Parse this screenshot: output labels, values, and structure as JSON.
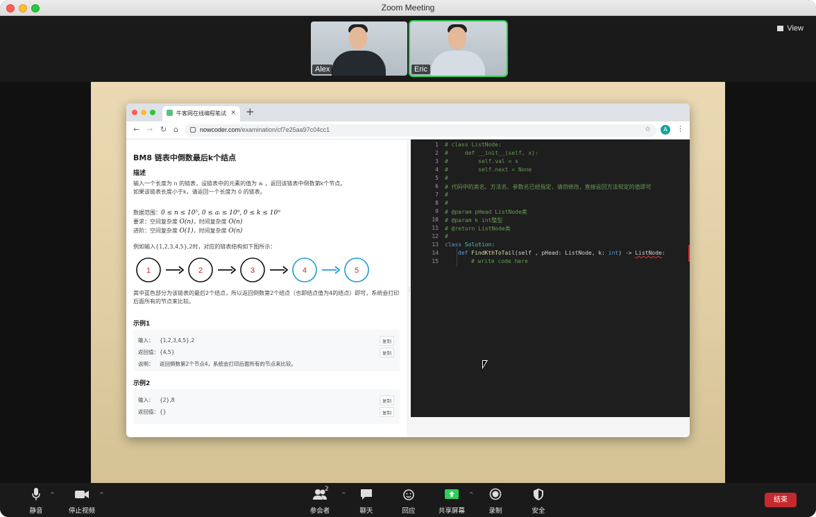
{
  "window": {
    "title": "Zoom Meeting"
  },
  "gallery": {
    "participants": [
      {
        "name": "Alex",
        "active": false
      },
      {
        "name": "Eric",
        "active": true
      }
    ],
    "view_label": "View"
  },
  "browser": {
    "tab_title": "牛客网在线编程笔试",
    "url_host": "nowcoder.com",
    "url_path": "/examination/cf7e25aa97c04cc1",
    "avatar_letter": "A"
  },
  "problem": {
    "title": "BM8  链表中倒数最后k个结点",
    "desc_heading": "描述",
    "desc_line1": "输入一个长度为 n 的链表，设链表中的元素的值为 aᵢ ，返回该链表中倒数第k个节点。",
    "desc_line2": "如果该链表长度小于k，请返回一个长度为 0 的链表。",
    "range_prefix": "数据范围：",
    "range_math": "0 ≤ n ≤ 10⁵,  0 ≤ aᵢ ≤ 10⁹,  0 ≤ k ≤ 10⁹",
    "req_prefix": "要求：空间复杂度 ",
    "req_math1": "O(n)",
    "req_mid": "，时间复杂度 ",
    "req_math2": "O(n)",
    "adv_prefix": "进阶：空间复杂度 ",
    "adv_math1": "O(1)",
    "adv_mid": "，时间复杂度 ",
    "adv_math2": "O(n)",
    "example_intro": "例如输入{1,2,3,4,5},2时，对应的链表结构如下图所示：",
    "diagram_nodes": [
      "1",
      "2",
      "3",
      "4",
      "5"
    ],
    "diagram_highlight_from": 3,
    "explain_line1": "其中蓝色部分为该链表的最后2个结点，所以返回倒数第2个结点（也即结点值为4的结点）即可，系统会打印",
    "explain_line2": "后面所有的节点来比较。",
    "example1": {
      "heading": "示例1",
      "input_label": "输入：",
      "input_value": "{1,2,3,4,5},2",
      "output_label": "返回值：",
      "output_value": "{4,5}",
      "note_label": "说明：",
      "note_value": "返回倒数第2个节点4，系统会打印后面所有的节点来比较。",
      "copy_label": "复制"
    },
    "example2": {
      "heading": "示例2",
      "input_label": "输入：",
      "input_value": "{2},8",
      "output_label": "返回值：",
      "output_value": "{}",
      "copy_label": "复制"
    }
  },
  "editor": {
    "line_numbers": [
      "1",
      "2",
      "3",
      "4",
      "5",
      "6",
      "7",
      "8",
      "9",
      "10",
      "11",
      "12",
      "13",
      "14",
      "15"
    ],
    "comments": {
      "l1": "# class ListNode:",
      "l2": "#     def __init__(self, x):",
      "l3": "#         self.val = x",
      "l4": "#         self.next = None",
      "l5": "#",
      "l6": "# 代码中的类名、方法名、参数名已经指定，请勿修改，直接返回方法规定的值即可",
      "l7": "#",
      "l8": "#",
      "l9": "# @param pHead ListNode类",
      "l10": "# @param k int整型",
      "l11": "# @return ListNode类",
      "l12": "#",
      "l15": "# write code here"
    },
    "l13_kw": "class",
    "l13_name": "Solution:",
    "l14_kw": "def",
    "l14_fn": "FindKthToTail",
    "l14_p1": "(self",
    "l14_p2": " , pHead: ListNode, k: ",
    "l14_int": "int",
    "l14_p3": ") -> ",
    "l14_ret": "ListNode",
    "l14_end": ":"
  },
  "controls": {
    "mute": "静音",
    "stop_video": "停止视频",
    "participants": "参会者",
    "participants_count": "2",
    "chat": "聊天",
    "reactions": "回应",
    "share_screen": "共享屏幕",
    "record": "录制",
    "security": "安全",
    "end": "结束"
  },
  "colors": {
    "zoom_green": "#2dd15a",
    "end_red": "#c42a2f",
    "node_blue": "#1e9bd7",
    "node_red": "#d8201f"
  }
}
